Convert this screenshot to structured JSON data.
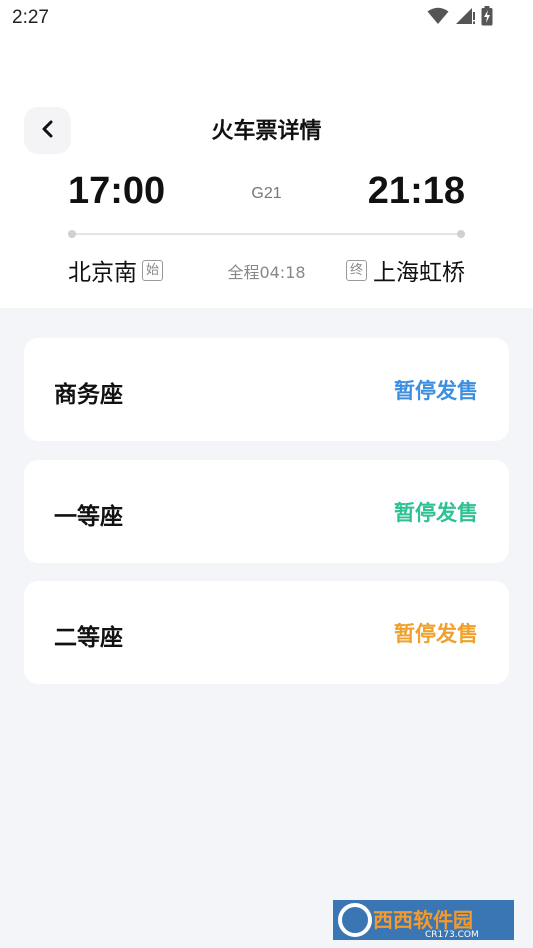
{
  "status_bar": {
    "time": "2:27",
    "icons": [
      "wifi-icon",
      "signal-icon",
      "battery-charging-icon"
    ]
  },
  "header": {
    "title": "火车票详情",
    "back_icon": "chevron-left-icon"
  },
  "journey": {
    "departure_time": "17:00",
    "arrival_time": "21:18",
    "train_number": "G21",
    "departure_station": "北京南",
    "departure_tag": "始",
    "arrival_station": "上海虹桥",
    "arrival_tag": "终",
    "duration": "全程04:18"
  },
  "seats": [
    {
      "name": "商务座",
      "status": "暂停发售",
      "status_color": "#3e8fe0"
    },
    {
      "name": "一等座",
      "status": "暂停发售",
      "status_color": "#2ec193"
    },
    {
      "name": "二等座",
      "status": "暂停发售",
      "status_color": "#efa12b"
    }
  ],
  "watermark": {
    "name": "西西软件园",
    "domain": "CR173.COM"
  }
}
